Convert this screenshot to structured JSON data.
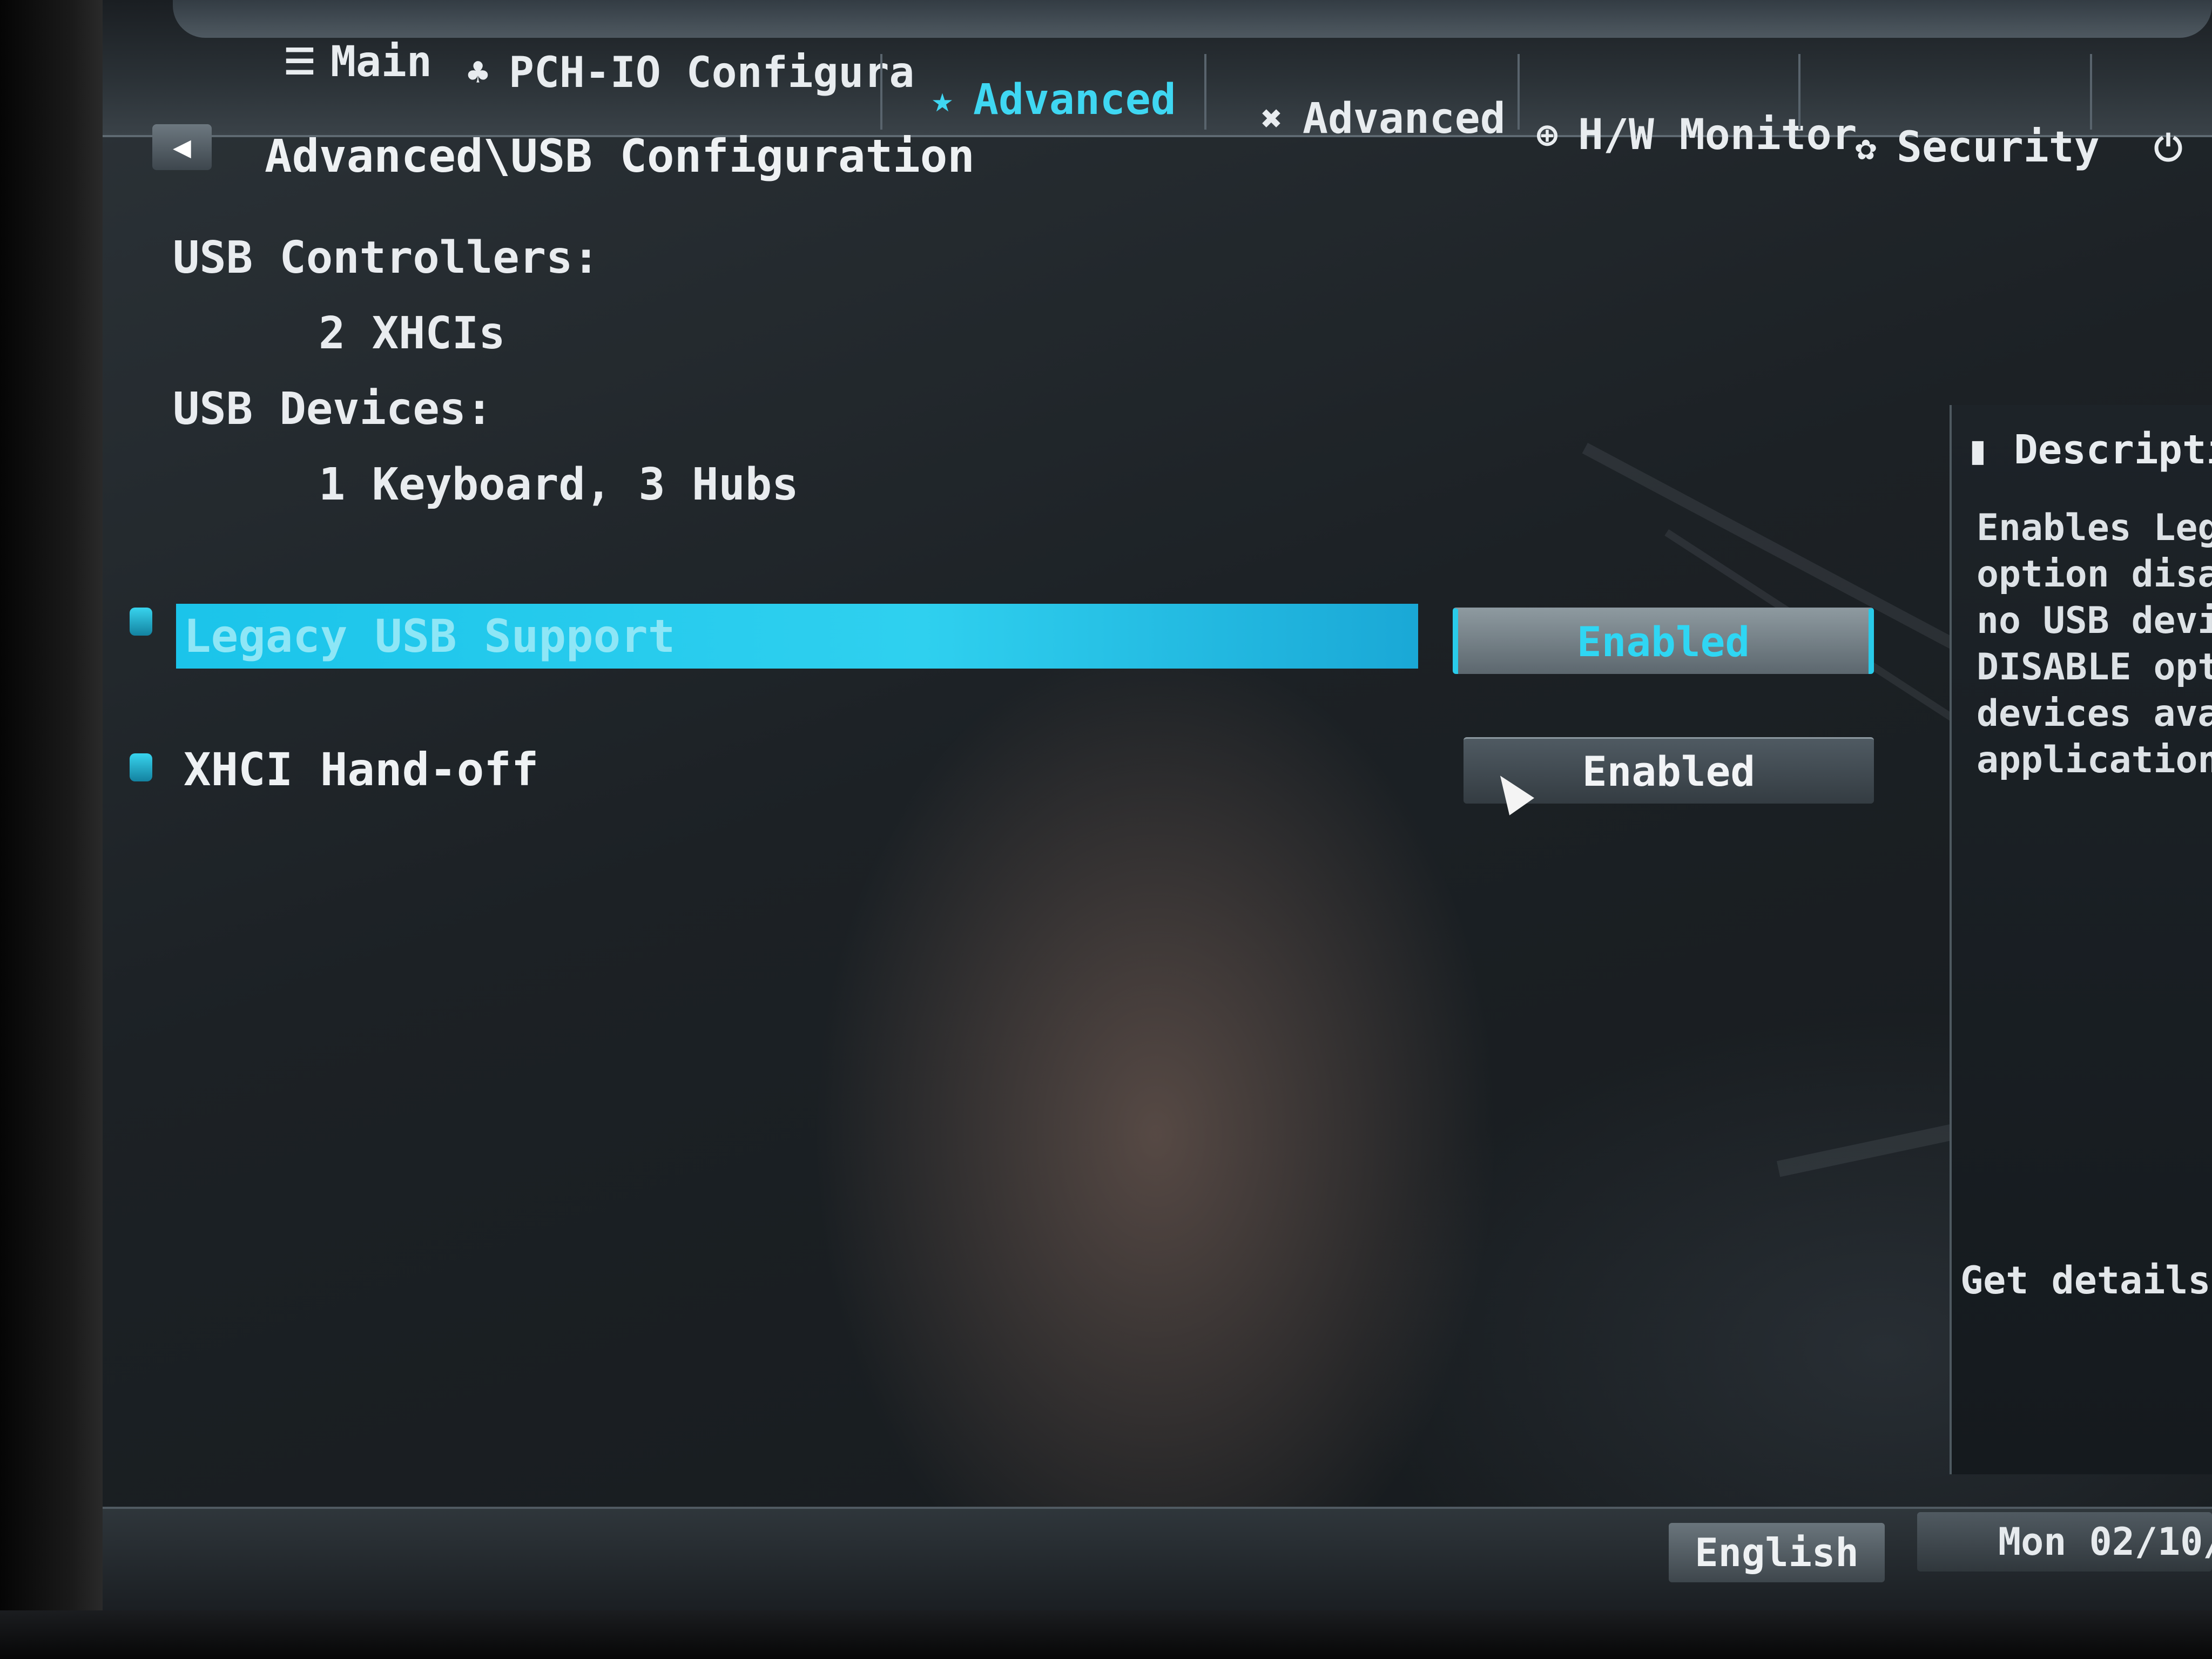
{
  "tabs": [
    {
      "label": "Main",
      "icon": "list-icon"
    },
    {
      "label": "PCH-IO Configura",
      "icon": "tree-icon"
    },
    {
      "label": "Advanced",
      "icon": "star-icon",
      "active": true
    },
    {
      "label": "Advanced",
      "icon": "tools-icon"
    },
    {
      "label": "H/W Monitor",
      "icon": "monitor-icon"
    },
    {
      "label": "Security",
      "icon": "shield-icon"
    }
  ],
  "breadcrumb": "Advanced\\USB Configuration",
  "info": {
    "usb_controllers_label": "USB Controllers:",
    "usb_controllers_value": "2 XHCIs",
    "usb_devices_label": "USB Devices:",
    "usb_devices_value": "1 Keyboard, 3 Hubs"
  },
  "settings": [
    {
      "label": "Legacy USB Support",
      "value": "Enabled",
      "selected": true
    },
    {
      "label": "XHCI Hand-off",
      "value": "Enabled",
      "selected": false
    }
  ],
  "description": {
    "title": "Description",
    "body": "Enables Legac\noption disabl\nno USB device\nDISABLE optio\ndevices avail\napplications.",
    "footer": "Get details vi"
  },
  "bottom": {
    "language": "English",
    "datetime": "Mon 02/10/"
  },
  "colors": {
    "accent": "#2fd0ef",
    "background": "#1c2125"
  }
}
